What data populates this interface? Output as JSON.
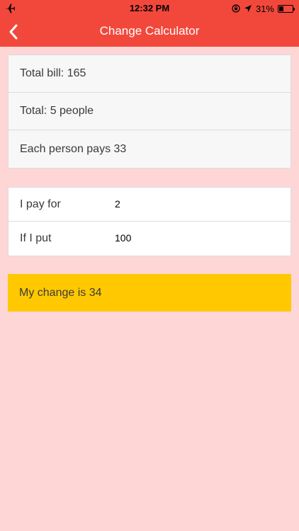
{
  "status_bar": {
    "time": "12:32 PM",
    "battery": "31%",
    "battery_level": 0.31,
    "icons": [
      "airplane-icon",
      "orientation-lock-icon",
      "location-icon",
      "battery-icon"
    ]
  },
  "nav": {
    "title": "Change Calculator",
    "back_icon": "chevron-left-icon"
  },
  "summary": {
    "total_bill": "Total bill: 165",
    "total_people": "Total: 5 people",
    "each_pays": "Each person pays 33"
  },
  "inputs": {
    "pay_for": {
      "label": "I pay for",
      "value": "2"
    },
    "put": {
      "label": "If I put",
      "value": "100"
    }
  },
  "result": {
    "text": "My change is 34"
  },
  "colors": {
    "header": "#f2483c",
    "background": "#ffd6d6",
    "result": "#ffc800",
    "summary_card": "#f7f7f7"
  }
}
